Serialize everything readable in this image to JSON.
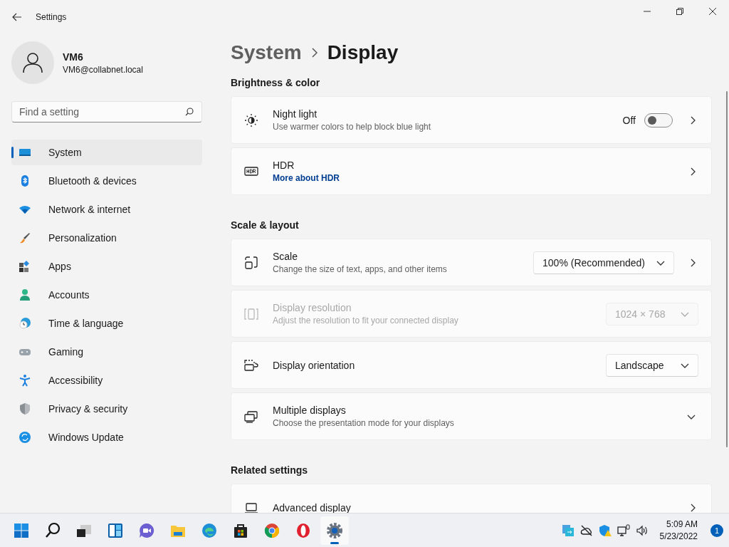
{
  "window": {
    "title": "Settings"
  },
  "user": {
    "name": "VM6",
    "email": "VM6@collabnet.local"
  },
  "search": {
    "placeholder": "Find a setting"
  },
  "sidebar": {
    "items": [
      {
        "label": "System",
        "selected": true
      },
      {
        "label": "Bluetooth & devices",
        "selected": false
      },
      {
        "label": "Network & internet",
        "selected": false
      },
      {
        "label": "Personalization",
        "selected": false
      },
      {
        "label": "Apps",
        "selected": false
      },
      {
        "label": "Accounts",
        "selected": false
      },
      {
        "label": "Time & language",
        "selected": false
      },
      {
        "label": "Gaming",
        "selected": false
      },
      {
        "label": "Accessibility",
        "selected": false
      },
      {
        "label": "Privacy & security",
        "selected": false
      },
      {
        "label": "Windows Update",
        "selected": false
      }
    ]
  },
  "breadcrumb": [
    "System",
    "Display"
  ],
  "sections": [
    {
      "title": "Brightness & color",
      "cards": [
        {
          "kind": "toggle",
          "title": "Night light",
          "subtitle": "Use warmer colors to help block blue light",
          "disabled": false,
          "toggle": {
            "label": "Off",
            "on": false
          }
        },
        {
          "kind": "link",
          "title": "HDR",
          "link": "More about HDR",
          "disabled": false
        }
      ]
    },
    {
      "title": "Scale & layout",
      "cards": [
        {
          "kind": "dropdown",
          "title": "Scale",
          "subtitle": "Change the size of text, apps, and other items",
          "disabled": false,
          "value": "100% (Recommended)",
          "chevron": true
        },
        {
          "kind": "dropdown",
          "title": "Display resolution",
          "subtitle": "Adjust the resolution to fit your connected display",
          "disabled": true,
          "value": "1024 × 768",
          "chevron": false
        },
        {
          "kind": "dropdown",
          "title": "Display orientation",
          "disabled": false,
          "value": "Landscape",
          "chevron": false
        },
        {
          "kind": "expander",
          "title": "Multiple displays",
          "subtitle": "Choose the presentation mode for your displays",
          "disabled": false,
          "expanded": false
        }
      ]
    },
    {
      "title": "Related settings",
      "cards": [
        {
          "kind": "link",
          "title": "Advanced display",
          "disabled": false
        }
      ]
    }
  ],
  "taskbar": {
    "apps": [
      {
        "selected": false
      },
      {
        "selected": false
      },
      {
        "selected": false
      },
      {
        "selected": false
      },
      {
        "selected": false
      },
      {
        "selected": false
      },
      {
        "selected": false
      },
      {
        "selected": false
      },
      {
        "selected": false
      },
      {
        "selected": false
      },
      {
        "selected": true
      }
    ],
    "time": "5:09 AM",
    "date": "5/23/2022",
    "notifications": "1"
  }
}
